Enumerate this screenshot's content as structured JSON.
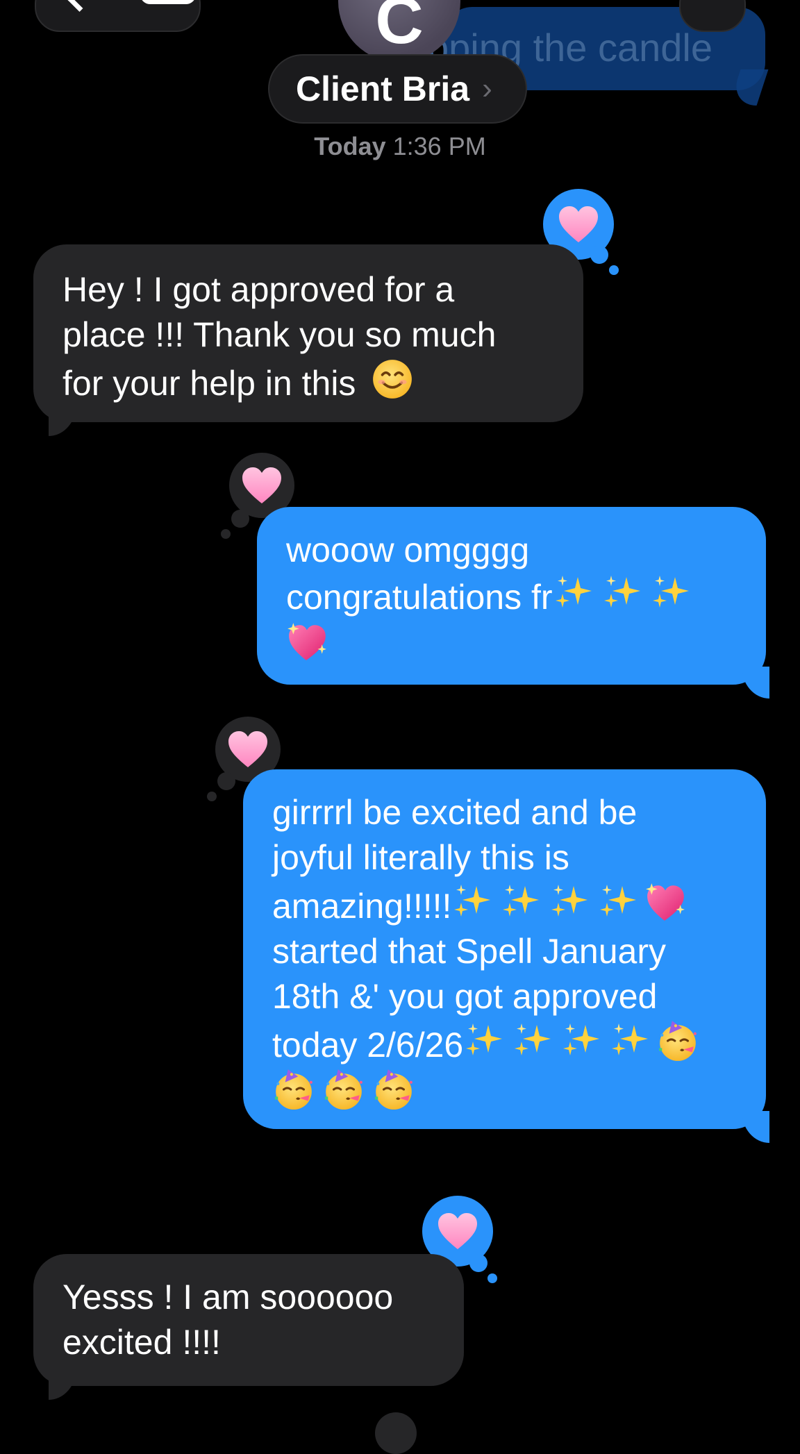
{
  "header": {
    "contact_name": "Client Bria",
    "contact_chevron": "›",
    "avatar_initial": "C",
    "previous_message_fragment": "pping the candle",
    "timestamp_day": "Today",
    "timestamp_time": "1:36 PM",
    "icons": [
      "back-chevron-icon",
      "video-camera-icon"
    ]
  },
  "messages": [
    {
      "direction": "incoming",
      "text": "Hey ! I got approved for a\nplace !!! Thank you so much\nfor your help in this",
      "trailing_emoji": "smiling-face-emoji",
      "reaction": "heart"
    },
    {
      "direction": "outgoing",
      "text_line1": "wooow omgggg",
      "text_line2": "congratulations fr",
      "emojis": [
        "sparkles",
        "sparkles",
        "sparkles",
        "sparkling-heart"
      ],
      "reaction": "heart"
    },
    {
      "direction": "outgoing",
      "text_line1": "girrrrl be excited and be",
      "text_line2": "joyful literally this is",
      "text_line3": "amazing!!!!!",
      "text_line4": "started that Spell January",
      "text_line5": "18th &' you got approved",
      "text_line6": "today 2/6/26",
      "emojis": [
        "sparkles",
        "sparkles",
        "sparkles",
        "sparkles",
        "sparkling-heart",
        "sparkles",
        "sparkles",
        "sparkles",
        "sparkles",
        "partying-face",
        "partying-face",
        "partying-face",
        "partying-face"
      ],
      "reaction": "heart"
    },
    {
      "direction": "incoming",
      "text": "Yesss ! I am soooooo\nexcited !!!!",
      "reaction": "heart"
    }
  ],
  "colors": {
    "background": "#000000",
    "incoming_bubble": "#262628",
    "outgoing_bubble": "#2a93fb",
    "timestamp": "#8e8e93",
    "heart": "#ff9ccc"
  }
}
